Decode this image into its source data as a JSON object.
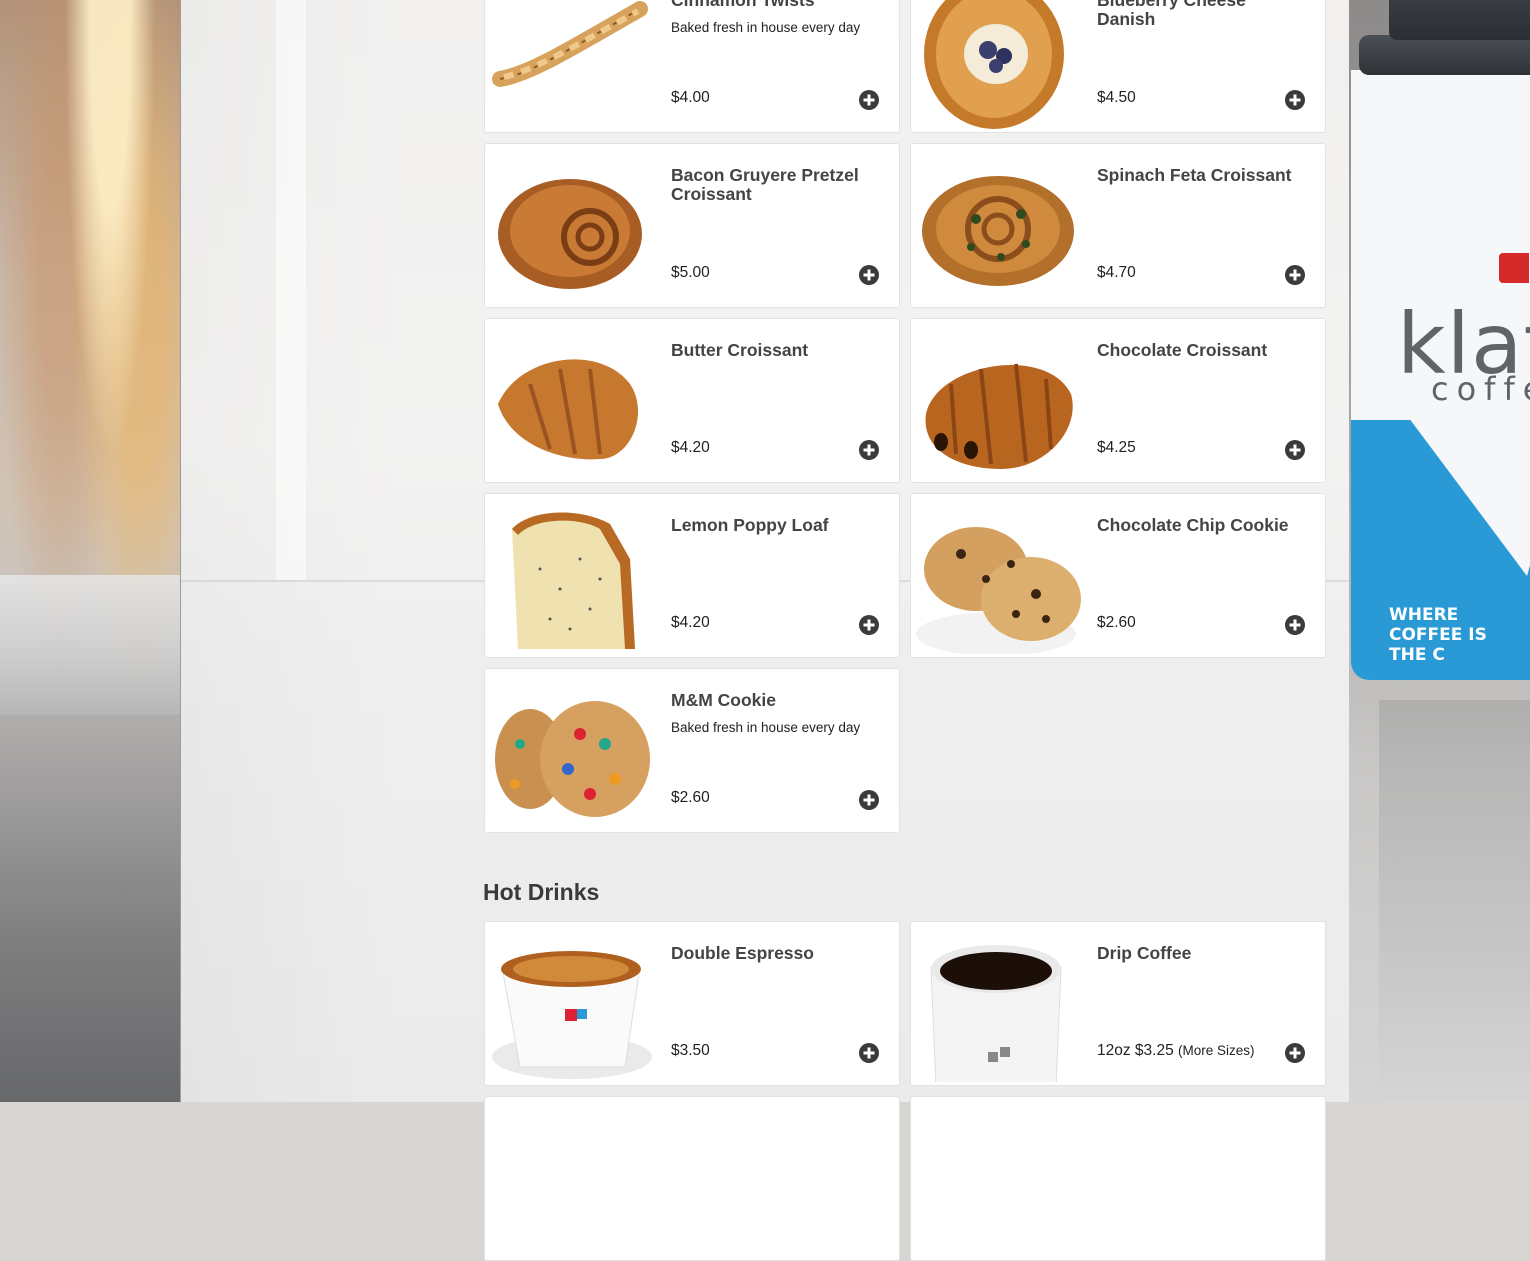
{
  "sections": {
    "pastries": {
      "items": [
        {
          "name": "Cinnamon Twists",
          "description": "Baked fresh in house every day",
          "price": "$4.00"
        },
        {
          "name": "Blueberry Cheese Danish",
          "description": "",
          "price": "$4.50"
        },
        {
          "name": "Bacon Gruyere Pretzel Croissant",
          "description": "",
          "price": "$5.00"
        },
        {
          "name": "Spinach Feta Croissant",
          "description": "",
          "price": "$4.70"
        },
        {
          "name": "Butter Croissant",
          "description": "",
          "price": "$4.20"
        },
        {
          "name": "Chocolate Croissant",
          "description": "",
          "price": "$4.25"
        },
        {
          "name": "Lemon Poppy Loaf",
          "description": "",
          "price": "$4.20"
        },
        {
          "name": "Chocolate Chip Cookie",
          "description": "",
          "price": "$2.60"
        },
        {
          "name": "M&M Cookie",
          "description": "Baked fresh in house every day",
          "price": "$2.60"
        }
      ]
    },
    "hot_drinks": {
      "title": "Hot Drinks",
      "items": [
        {
          "name": "Double Espresso",
          "description": "",
          "price": "$3.50"
        },
        {
          "name": "Drip Coffee",
          "description": "",
          "price": "12oz $3.25",
          "more_sizes": "(More Sizes)"
        }
      ]
    }
  },
  "background": {
    "brand": "klatch",
    "brand_sub": "coffee",
    "tagline": "WHERE COFFEE IS THE C"
  }
}
